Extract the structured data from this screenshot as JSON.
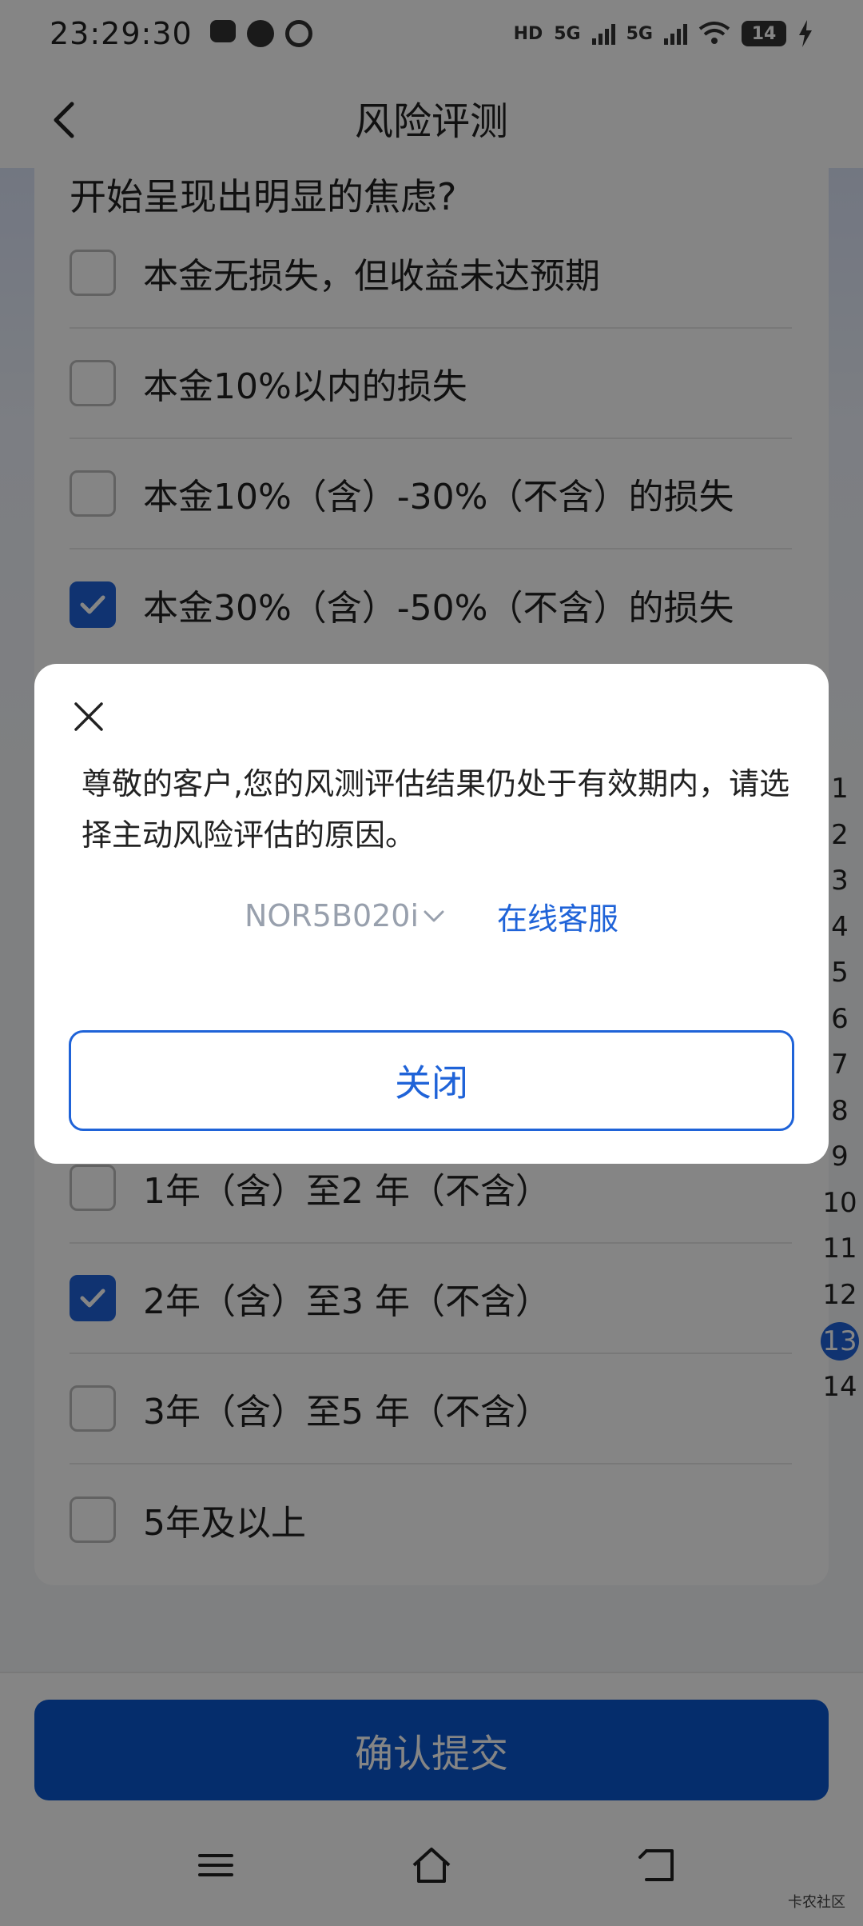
{
  "status_bar": {
    "time": "23:29:30",
    "network": [
      "HD",
      "5G",
      "5G"
    ],
    "battery": "14",
    "icons": [
      "robot-icon",
      "message-icon",
      "alarm-icon",
      "signal-icon",
      "wifi-icon",
      "battery-icon",
      "charging-icon"
    ]
  },
  "header": {
    "title": "风险评测",
    "back_icon": "chevron-left-icon"
  },
  "question": {
    "text": "开始呈现出明显的焦虑?",
    "options": [
      {
        "label": "本金无损失，但收益未达预期",
        "checked": false
      },
      {
        "label": "本金10%以内的损失",
        "checked": false
      },
      {
        "label": "本金10%（含）-30%（不含）的损失",
        "checked": false
      },
      {
        "label": "本金30%（含）-50%（不含）的损失",
        "checked": true
      }
    ]
  },
  "question2": {
    "options": [
      {
        "label": "1年（含）至2 年（不含）",
        "checked": false
      },
      {
        "label": "2年（含）至3 年（不含）",
        "checked": true
      },
      {
        "label": "3年（含）至5 年（不含）",
        "checked": false
      },
      {
        "label": "5年及以上",
        "checked": false
      }
    ]
  },
  "index": {
    "items": [
      "1",
      "2",
      "3",
      "4",
      "5",
      "6",
      "7",
      "8",
      "9",
      "10",
      "11",
      "12",
      "13",
      "14"
    ],
    "active": "13"
  },
  "bottom": {
    "submit_label": "确认提交",
    "watermark": "卡农社区"
  },
  "dialog": {
    "message": "尊敬的客户,您的风测评估结果仍处于有效期内，请选择主动风险评估的原因。",
    "code": "NOR5B020i",
    "service_link": "在线客服",
    "close_label": "关闭"
  },
  "colors": {
    "accent": "#1f63d8",
    "submit": "#0a56cf",
    "overlay": "rgba(0,0,0,0.48)"
  }
}
